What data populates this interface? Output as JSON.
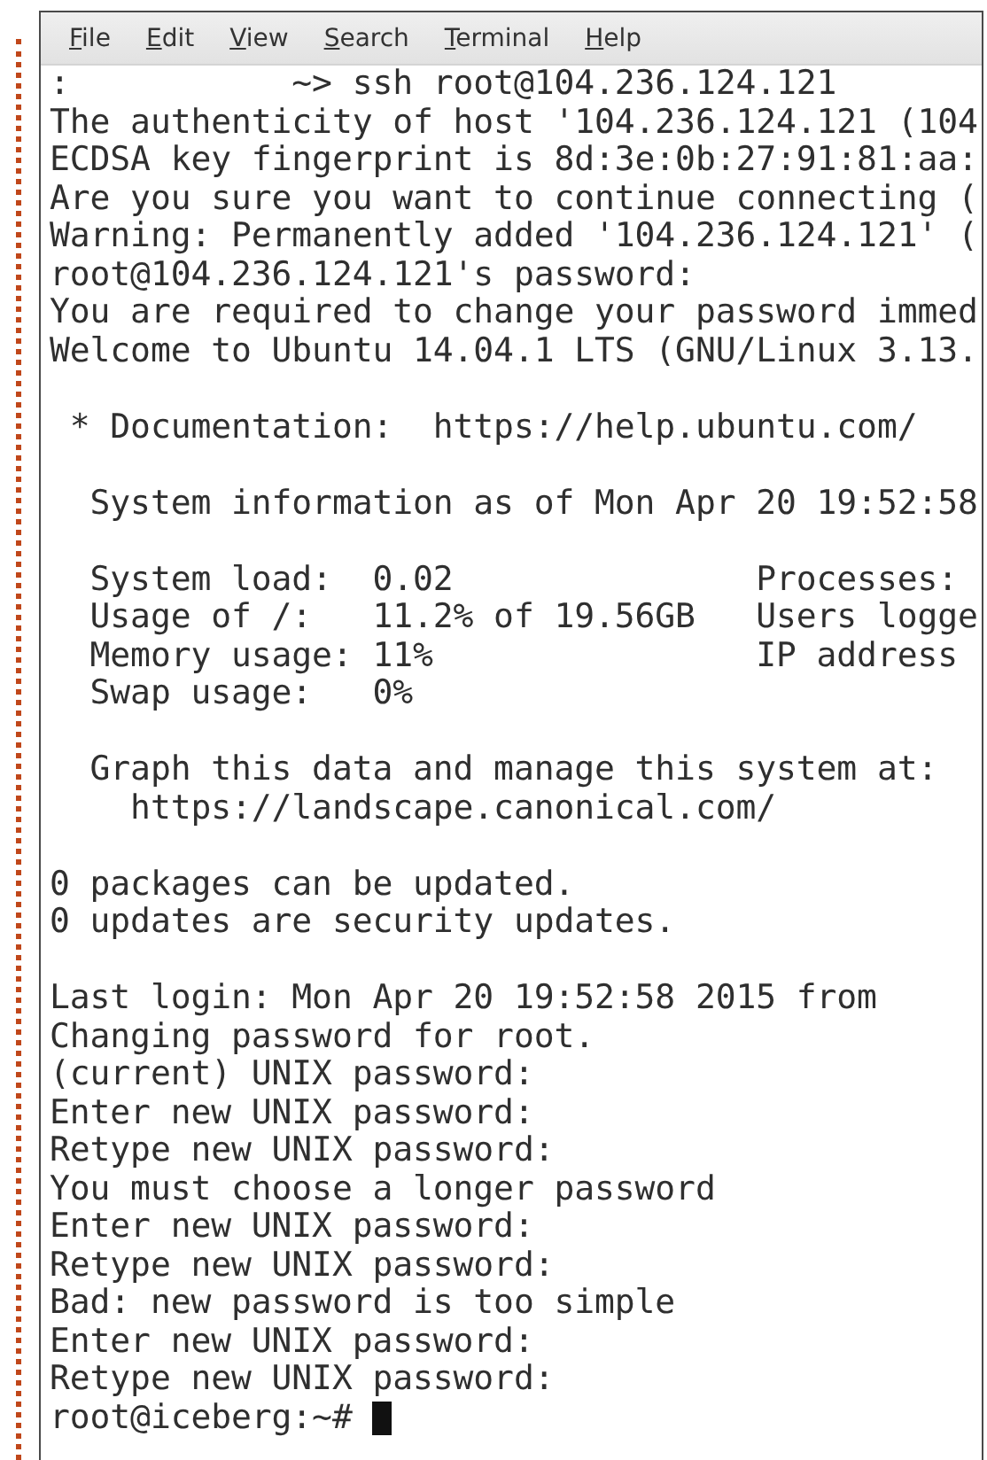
{
  "menu": [
    "File",
    "Edit",
    "View",
    "Search",
    "Terminal",
    "Help"
  ],
  "terminal": {
    "blocks": [
      [
        ":           ~> ssh root@104.236.124.121",
        "The authenticity of host '104.236.124.121 (104",
        "ECDSA key fingerprint is 8d:3e:0b:27:91:81:aa:",
        "Are you sure you want to continue connecting (",
        "Warning: Permanently added '104.236.124.121' (",
        "root@104.236.124.121's password:",
        "You are required to change your password immed",
        "Welcome to Ubuntu 14.04.1 LTS (GNU/Linux 3.13."
      ],
      [
        " * Documentation:  https://help.ubuntu.com/"
      ],
      [
        "  System information as of Mon Apr 20 19:52:58"
      ],
      [
        "  System load:  0.02               Processes:",
        "  Usage of /:   11.2% of 19.56GB   Users logge",
        "  Memory usage: 11%                IP address",
        "  Swap usage:   0%"
      ],
      [
        "  Graph this data and manage this system at:",
        "    https://landscape.canonical.com/"
      ],
      [
        "0 packages can be updated.",
        "0 updates are security updates."
      ],
      [
        "Last login: Mon Apr 20 19:52:58 2015 from",
        "Changing password for root.",
        "(current) UNIX password:",
        "Enter new UNIX password:",
        "Retype new UNIX password:",
        "You must choose a longer password",
        "Enter new UNIX password:",
        "Retype new UNIX password:",
        "Bad: new password is too simple",
        "Enter new UNIX password:",
        "Retype new UNIX password:"
      ]
    ],
    "prompt": "root@iceberg:~#",
    "cursor": true
  }
}
